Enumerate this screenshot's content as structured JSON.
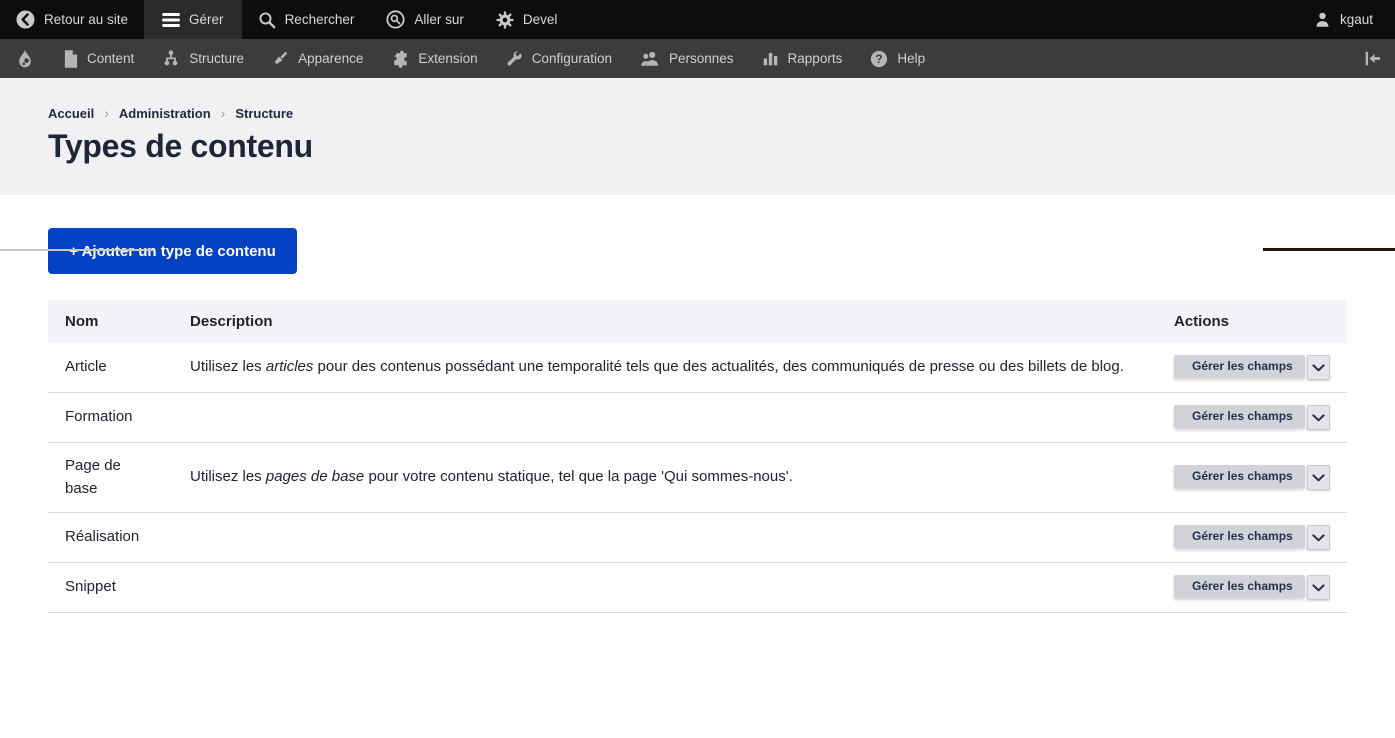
{
  "top_bar": {
    "back": "Retour au site",
    "manage": "Gérer",
    "search": "Rechercher",
    "goto": "Aller sur",
    "devel": "Devel",
    "user": "kgaut"
  },
  "admin_menu": {
    "content": "Content",
    "structure": "Structure",
    "appearance": "Apparence",
    "extension": "Extension",
    "configuration": "Configuration",
    "people": "Personnes",
    "reports": "Rapports",
    "help": "Help"
  },
  "breadcrumb": {
    "home": "Accueil",
    "administration": "Administration",
    "structure": "Structure"
  },
  "page": {
    "title": "Types de contenu"
  },
  "toolbar": {
    "add_button": "+ Ajouter un type de contenu"
  },
  "table": {
    "headers": {
      "name": "Nom",
      "description": "Description",
      "actions": "Actions"
    },
    "rows": [
      {
        "name": "Article",
        "desc_before": "Utilisez les ",
        "desc_em": "articles",
        "desc_after": " pour des contenus possédant une temporalité tels que des actualités, des communiqués de presse ou des billets de blog.",
        "action": "Gérer les champs"
      },
      {
        "name": "Formation",
        "action": "Gérer les champs"
      },
      {
        "name": "Page de base",
        "desc_before": "Utilisez les ",
        "desc_em": "pages de base",
        "desc_after": " pour votre contenu statique, tel que la page 'Qui sommes-nous'.",
        "action": "Gérer les champs"
      },
      {
        "name": "Réalisation",
        "action": "Gérer les champs"
      },
      {
        "name": "Snippet",
        "action": "Gérer les champs"
      }
    ]
  },
  "colors": {
    "primary_button": "#0342c2",
    "topbar_bg": "#0d0d0d",
    "menubar_bg": "#3d3b3b",
    "header_band_bg": "#f1f1f4",
    "table_header_bg": "#f3f4f9",
    "row_border": "#d9d9de",
    "dropbutton_bg": "#d2d3d9"
  },
  "icons": {
    "back": "chevron-left-circle",
    "manage": "hamburger-menu",
    "search": "magnifier",
    "goto": "circled-magnifier",
    "devel": "gear",
    "user": "person",
    "logo": "drupal-droplet",
    "content": "document",
    "structure": "sitemap",
    "appearance": "paintbrush",
    "extension": "puzzle-piece",
    "configuration": "wrench",
    "people": "two-persons",
    "reports": "bar-chart",
    "help": "question-circle",
    "collapse": "collapse-left-arrow",
    "dropdown": "chevron-down"
  }
}
